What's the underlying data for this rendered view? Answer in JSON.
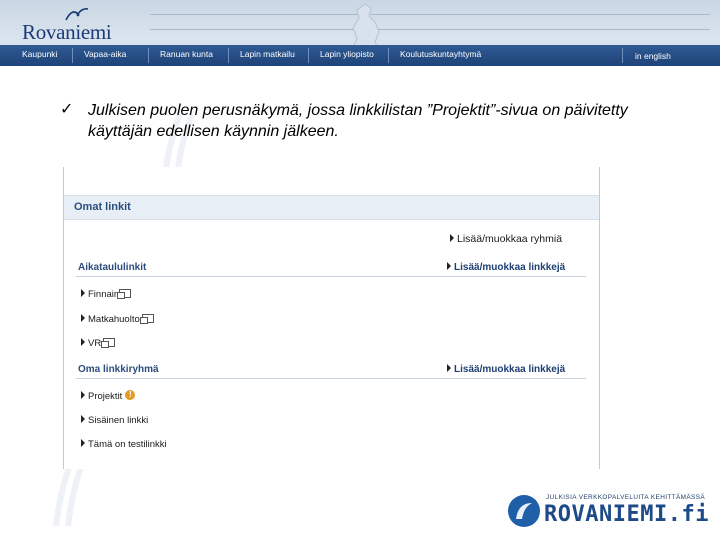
{
  "header": {
    "logo_text": "Rovaniemi",
    "nav": [
      {
        "label": "Kaupunki"
      },
      {
        "label": "Vapaa-aika"
      },
      {
        "label": "Ranuan kunta"
      },
      {
        "label": "Lapin matkailu"
      },
      {
        "label": "Lapin yliopisto"
      },
      {
        "label": "Koulutuskuntayhtymä"
      }
    ],
    "english_label": "in english"
  },
  "slide": {
    "bullet_symbol": "✓",
    "bullet_text": "Julkisen puolen perusnäkymä, jossa linkkilistan ”Projektit”-sivua on päivitetty käyttäjän edellisen käynnin jälkeen."
  },
  "panel": {
    "title": "Omat linkit",
    "groups_link": "Lisää/muokkaa ryhmiä",
    "sections": [
      {
        "heading": "Aikataululinkit",
        "edit_link": "Lisää/muokkaa linkkejä",
        "items": [
          {
            "label": "Finnair"
          },
          {
            "label": "Matkahuolto"
          },
          {
            "label": "VR"
          }
        ]
      },
      {
        "heading": "Oma linkkiryhmä",
        "edit_link": "Lisää/muokkaa linkkejä",
        "items": [
          {
            "label": "Projektit",
            "badge": "!"
          },
          {
            "label": "Sisäinen linkki"
          },
          {
            "label": "Tämä on testilinkki"
          }
        ]
      }
    ]
  },
  "brand": {
    "tagline": "JULKISIA VERKKOPALVELUITA KEHITTÄMÄSSÄ",
    "name": "ROVANIEMI.fi"
  },
  "colors": {
    "navbar": "#1e4378",
    "heading": "#2b4d7e",
    "brand_blue": "#1f5fa8",
    "badge": "#e39b23"
  }
}
